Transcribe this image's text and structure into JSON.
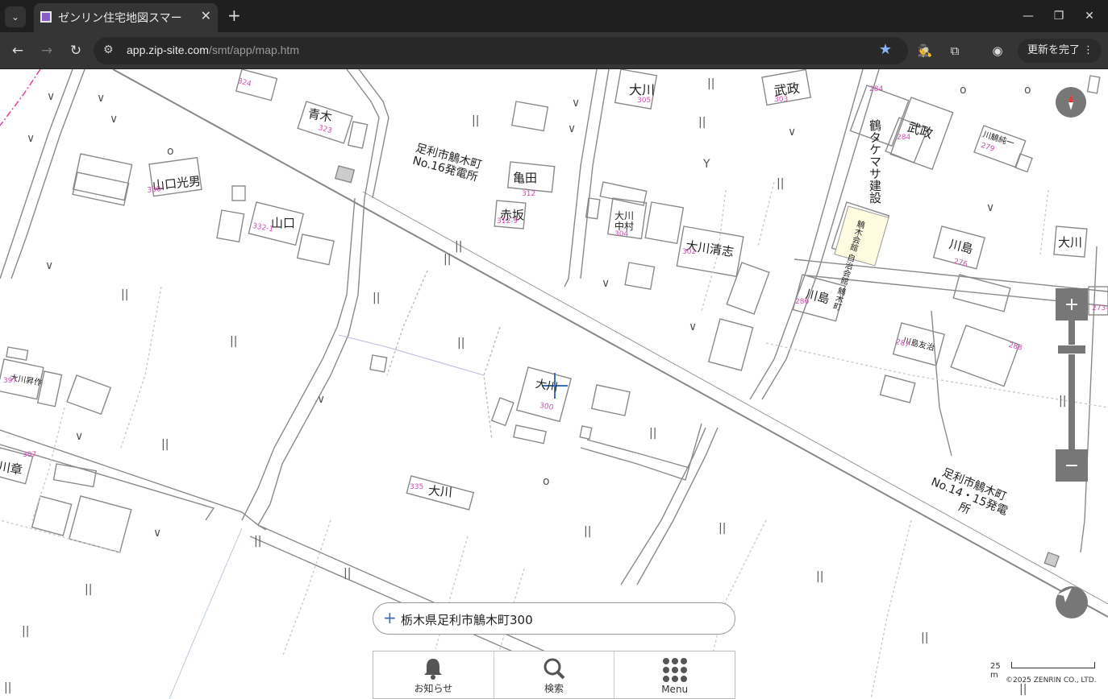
{
  "browser": {
    "tab_title": "ゼンリン住宅地図スマー",
    "url_domain": "app.zip-site.com",
    "url_path": "/smt/app/map.htm",
    "update_label": "更新を完了"
  },
  "map": {
    "labels": [
      "青木",
      "足利市鵤木町 No.16発電所",
      "亀田",
      "赤坂",
      "大川",
      "武政",
      "武政",
      "川鵤純一",
      "鶴タケマサ建設",
      "山口光男",
      "山口",
      "大川中村",
      "大川清志",
      "鵤木会館 自治会館 鵤木町",
      "川島",
      "大川",
      "川島",
      "川島友治",
      "大川昇作",
      "大川",
      "大川",
      "川章",
      "足利市鵤木町 No.14・15発電所"
    ],
    "numbers": [
      "324",
      "323",
      "330",
      "332-1",
      "312",
      "312-9",
      "305",
      "303",
      "284",
      "284",
      "279",
      "304",
      "302",
      "276",
      "286",
      "287",
      "288",
      "397",
      "387",
      "335",
      "300",
      "273-2"
    ]
  },
  "address": {
    "text": "栃木県足利市鵤木町300"
  },
  "nav": {
    "notice": "お知らせ",
    "search": "検索",
    "menu": "Menu"
  },
  "scale": {
    "label": "25 m"
  },
  "copyright": "©2025 ZENRIN CO., LTD."
}
